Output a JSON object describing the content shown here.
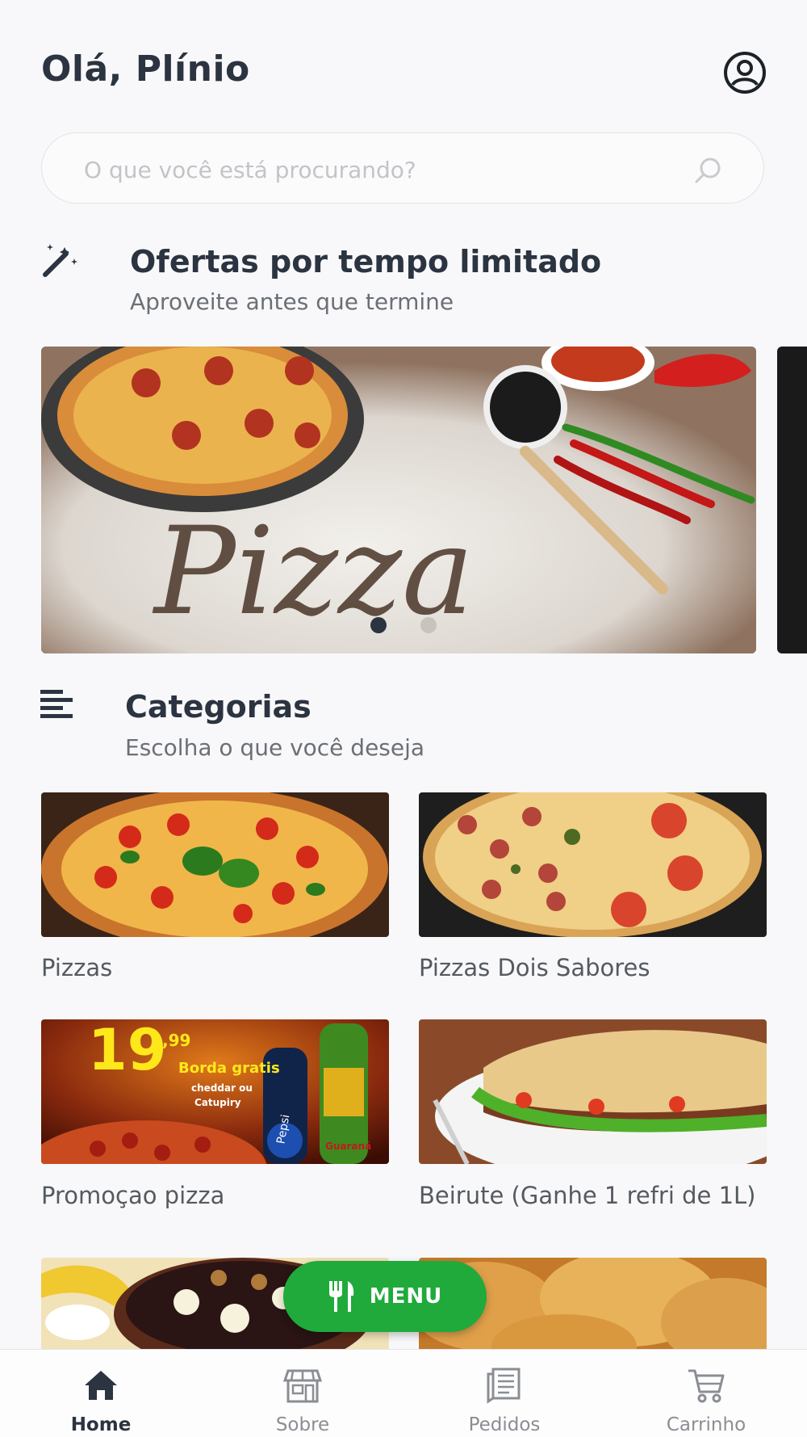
{
  "header": {
    "greeting": "Olá, Plínio"
  },
  "search": {
    "placeholder": "O que você está procurando?"
  },
  "offers": {
    "title": "Ofertas por tempo limitado",
    "subtitle": "Aproveite antes que termine"
  },
  "banner": {
    "text": "Pizza",
    "slide_count": 2,
    "active_slide": 1
  },
  "categories": {
    "title": "Categorias",
    "subtitle": "Escolha o que você deseja",
    "items": [
      {
        "label": "Pizzas"
      },
      {
        "label": "Pizzas Dois Sabores"
      },
      {
        "label": "Promoçao pizza",
        "promo_price_big": "19",
        "promo_price_small": ",99",
        "promo_line1": "Borda gratis",
        "promo_line2": "cheddar ou",
        "promo_line3": "Catupiry",
        "promo_brand1": "Pepsi",
        "promo_brand2": "Guaraná"
      },
      {
        "label": "Beirute (Ganhe 1 refri de 1L)"
      },
      {
        "label": ""
      },
      {
        "label": ""
      }
    ]
  },
  "fab": {
    "label": "MENU",
    "icon": "utensils-icon",
    "color": "#1faa3b"
  },
  "bottom_nav": [
    {
      "label": "Home",
      "icon": "home-icon",
      "active": true
    },
    {
      "label": "Sobre",
      "icon": "store-icon",
      "active": false
    },
    {
      "label": "Pedidos",
      "icon": "orders-icon",
      "active": false
    },
    {
      "label": "Carrinho",
      "icon": "cart-icon",
      "active": false
    }
  ],
  "colors": {
    "text_dark": "#2b3440",
    "text_muted": "#6b6f76",
    "accent_green": "#1faa3b",
    "background": "#f8f8fa"
  }
}
